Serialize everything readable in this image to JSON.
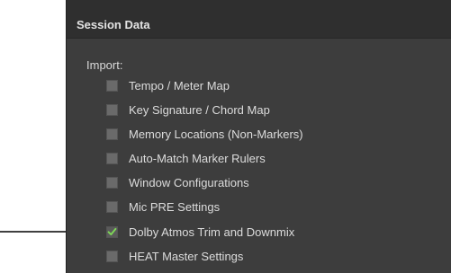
{
  "panel": {
    "title": "Session Data",
    "import_label": "Import:",
    "options": [
      {
        "label": "Tempo / Meter Map",
        "checked": false
      },
      {
        "label": "Key Signature / Chord Map",
        "checked": false
      },
      {
        "label": "Memory Locations (Non-Markers)",
        "checked": false
      },
      {
        "label": "Auto-Match Marker Rulers",
        "checked": false
      },
      {
        "label": "Window Configurations",
        "checked": false
      },
      {
        "label": "Mic PRE Settings",
        "checked": false
      },
      {
        "label": "Dolby Atmos Trim and Downmix",
        "checked": true
      },
      {
        "label": "HEAT Master Settings",
        "checked": false
      }
    ]
  },
  "colors": {
    "panel_bg": "#3d3d3d",
    "header_bg": "#2f2f2f",
    "checkmark": "#7ed957",
    "arrow": "#000000"
  },
  "icons": {
    "checkmark": "checkmark-icon",
    "arrow": "callout-arrow-icon"
  }
}
